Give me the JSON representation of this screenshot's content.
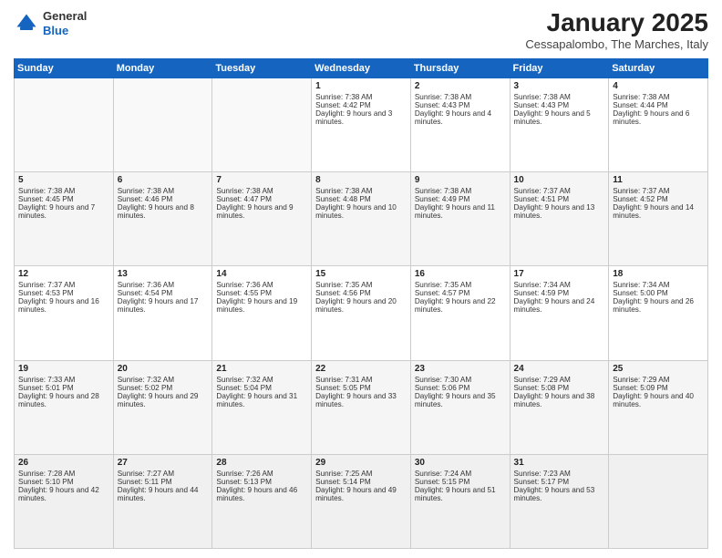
{
  "header": {
    "logo_line1": "General",
    "logo_line2": "Blue",
    "title": "January 2025",
    "subtitle": "Cessapalombo, The Marches, Italy"
  },
  "days_of_week": [
    "Sunday",
    "Monday",
    "Tuesday",
    "Wednesday",
    "Thursday",
    "Friday",
    "Saturday"
  ],
  "weeks": [
    [
      {
        "day": "",
        "content": ""
      },
      {
        "day": "",
        "content": ""
      },
      {
        "day": "",
        "content": ""
      },
      {
        "day": "1",
        "content": "Sunrise: 7:38 AM\nSunset: 4:42 PM\nDaylight: 9 hours and 3 minutes."
      },
      {
        "day": "2",
        "content": "Sunrise: 7:38 AM\nSunset: 4:43 PM\nDaylight: 9 hours and 4 minutes."
      },
      {
        "day": "3",
        "content": "Sunrise: 7:38 AM\nSunset: 4:43 PM\nDaylight: 9 hours and 5 minutes."
      },
      {
        "day": "4",
        "content": "Sunrise: 7:38 AM\nSunset: 4:44 PM\nDaylight: 9 hours and 6 minutes."
      }
    ],
    [
      {
        "day": "5",
        "content": "Sunrise: 7:38 AM\nSunset: 4:45 PM\nDaylight: 9 hours and 7 minutes."
      },
      {
        "day": "6",
        "content": "Sunrise: 7:38 AM\nSunset: 4:46 PM\nDaylight: 9 hours and 8 minutes."
      },
      {
        "day": "7",
        "content": "Sunrise: 7:38 AM\nSunset: 4:47 PM\nDaylight: 9 hours and 9 minutes."
      },
      {
        "day": "8",
        "content": "Sunrise: 7:38 AM\nSunset: 4:48 PM\nDaylight: 9 hours and 10 minutes."
      },
      {
        "day": "9",
        "content": "Sunrise: 7:38 AM\nSunset: 4:49 PM\nDaylight: 9 hours and 11 minutes."
      },
      {
        "day": "10",
        "content": "Sunrise: 7:37 AM\nSunset: 4:51 PM\nDaylight: 9 hours and 13 minutes."
      },
      {
        "day": "11",
        "content": "Sunrise: 7:37 AM\nSunset: 4:52 PM\nDaylight: 9 hours and 14 minutes."
      }
    ],
    [
      {
        "day": "12",
        "content": "Sunrise: 7:37 AM\nSunset: 4:53 PM\nDaylight: 9 hours and 16 minutes."
      },
      {
        "day": "13",
        "content": "Sunrise: 7:36 AM\nSunset: 4:54 PM\nDaylight: 9 hours and 17 minutes."
      },
      {
        "day": "14",
        "content": "Sunrise: 7:36 AM\nSunset: 4:55 PM\nDaylight: 9 hours and 19 minutes."
      },
      {
        "day": "15",
        "content": "Sunrise: 7:35 AM\nSunset: 4:56 PM\nDaylight: 9 hours and 20 minutes."
      },
      {
        "day": "16",
        "content": "Sunrise: 7:35 AM\nSunset: 4:57 PM\nDaylight: 9 hours and 22 minutes."
      },
      {
        "day": "17",
        "content": "Sunrise: 7:34 AM\nSunset: 4:59 PM\nDaylight: 9 hours and 24 minutes."
      },
      {
        "day": "18",
        "content": "Sunrise: 7:34 AM\nSunset: 5:00 PM\nDaylight: 9 hours and 26 minutes."
      }
    ],
    [
      {
        "day": "19",
        "content": "Sunrise: 7:33 AM\nSunset: 5:01 PM\nDaylight: 9 hours and 28 minutes."
      },
      {
        "day": "20",
        "content": "Sunrise: 7:32 AM\nSunset: 5:02 PM\nDaylight: 9 hours and 29 minutes."
      },
      {
        "day": "21",
        "content": "Sunrise: 7:32 AM\nSunset: 5:04 PM\nDaylight: 9 hours and 31 minutes."
      },
      {
        "day": "22",
        "content": "Sunrise: 7:31 AM\nSunset: 5:05 PM\nDaylight: 9 hours and 33 minutes."
      },
      {
        "day": "23",
        "content": "Sunrise: 7:30 AM\nSunset: 5:06 PM\nDaylight: 9 hours and 35 minutes."
      },
      {
        "day": "24",
        "content": "Sunrise: 7:29 AM\nSunset: 5:08 PM\nDaylight: 9 hours and 38 minutes."
      },
      {
        "day": "25",
        "content": "Sunrise: 7:29 AM\nSunset: 5:09 PM\nDaylight: 9 hours and 40 minutes."
      }
    ],
    [
      {
        "day": "26",
        "content": "Sunrise: 7:28 AM\nSunset: 5:10 PM\nDaylight: 9 hours and 42 minutes."
      },
      {
        "day": "27",
        "content": "Sunrise: 7:27 AM\nSunset: 5:11 PM\nDaylight: 9 hours and 44 minutes."
      },
      {
        "day": "28",
        "content": "Sunrise: 7:26 AM\nSunset: 5:13 PM\nDaylight: 9 hours and 46 minutes."
      },
      {
        "day": "29",
        "content": "Sunrise: 7:25 AM\nSunset: 5:14 PM\nDaylight: 9 hours and 49 minutes."
      },
      {
        "day": "30",
        "content": "Sunrise: 7:24 AM\nSunset: 5:15 PM\nDaylight: 9 hours and 51 minutes."
      },
      {
        "day": "31",
        "content": "Sunrise: 7:23 AM\nSunset: 5:17 PM\nDaylight: 9 hours and 53 minutes."
      },
      {
        "day": "",
        "content": ""
      }
    ]
  ]
}
